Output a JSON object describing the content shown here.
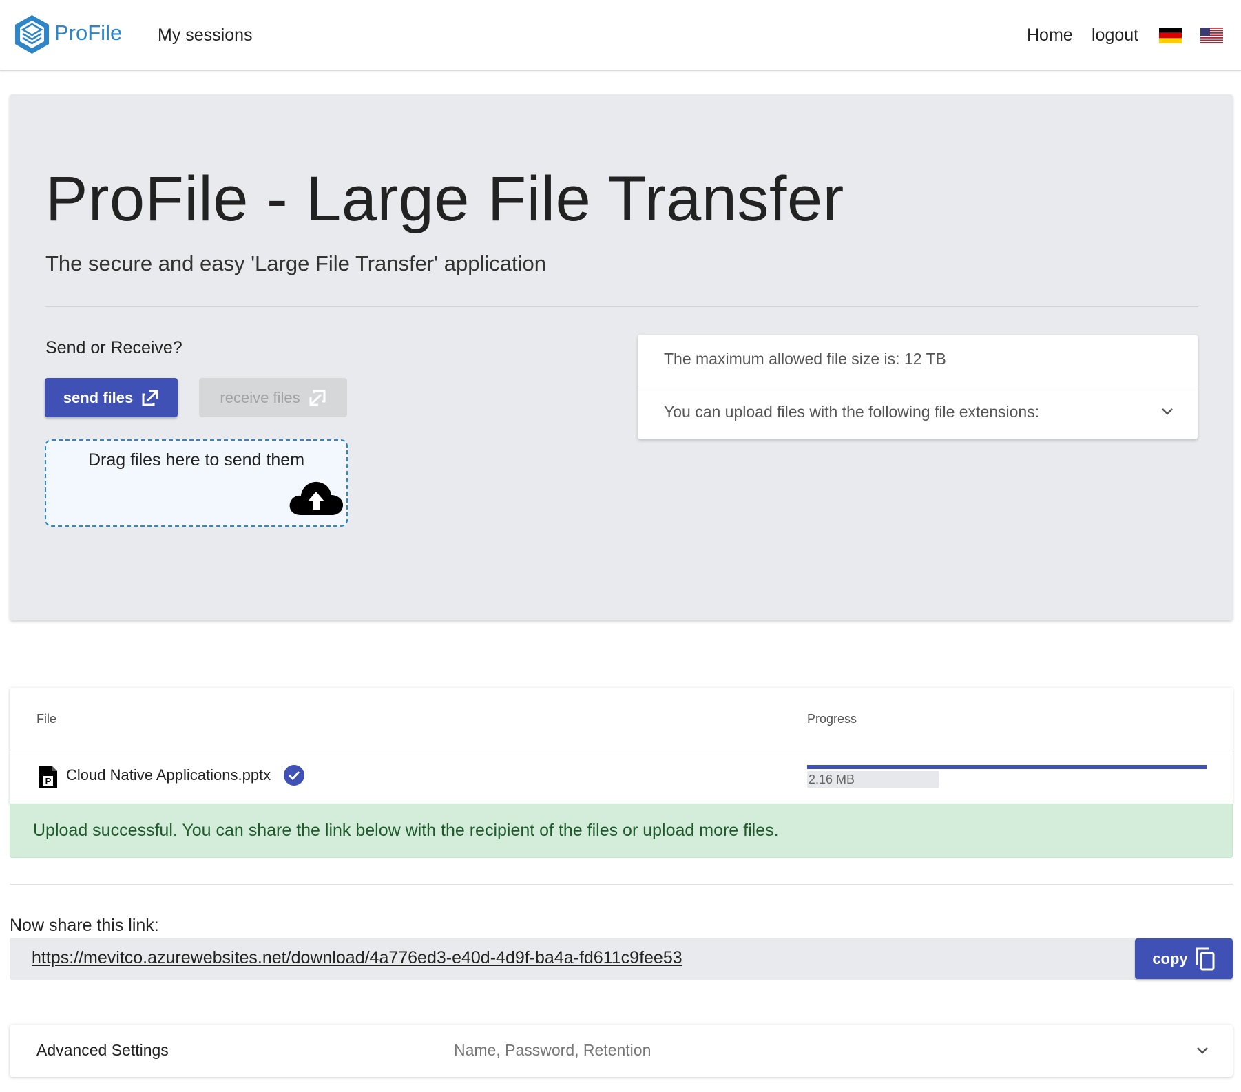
{
  "header": {
    "brand": "ProFile",
    "nav_sessions": "My sessions",
    "nav_home": "Home",
    "nav_logout": "logout",
    "languages": [
      "de",
      "en-us"
    ]
  },
  "jumbotron": {
    "title": "ProFile - Large File Transfer",
    "subtitle": "The secure and easy 'Large File Transfer' application",
    "send_or_receive_label": "Send or Receive?",
    "send_button": "send files",
    "receive_button": "receive files",
    "dropzone_text": "Drag files here to send them",
    "max_size_text": "The maximum allowed file size is: 12 TB",
    "extensions_text": "You can upload files with the following file extensions:"
  },
  "files_table": {
    "col_file": "File",
    "col_progress": "Progress",
    "rows": [
      {
        "name": "Cloud Native Applications.pptx",
        "size": "2.16 MB",
        "progress": 1.0,
        "status": "complete"
      }
    ]
  },
  "success_message": "Upload successful. You can share the link below with the recipient of the files or upload more files.",
  "share": {
    "label": "Now share this link:",
    "link": "https://mevitco.azurewebsites.net/download/4a776ed3-e40d-4d9f-ba4a-fd611c9fee53",
    "copy_button": "copy"
  },
  "advanced": {
    "title": "Advanced Settings",
    "description": "Name, Password, Retention"
  },
  "colors": {
    "primary": "#3f51b5",
    "brand": "#2e86c8",
    "success_bg": "#d4edda",
    "success_text": "#1e5a2a",
    "dropzone_border": "#2b86d4"
  },
  "icons": {
    "logo": "profile-cube-logo",
    "send": "arrow-up-right-icon",
    "receive": "arrow-down-left-icon",
    "upload": "cloud-upload-icon",
    "file": "powerpoint-file-icon",
    "check": "check-circle-icon",
    "copy": "copy-icon",
    "expand": "chevron-down-icon"
  }
}
